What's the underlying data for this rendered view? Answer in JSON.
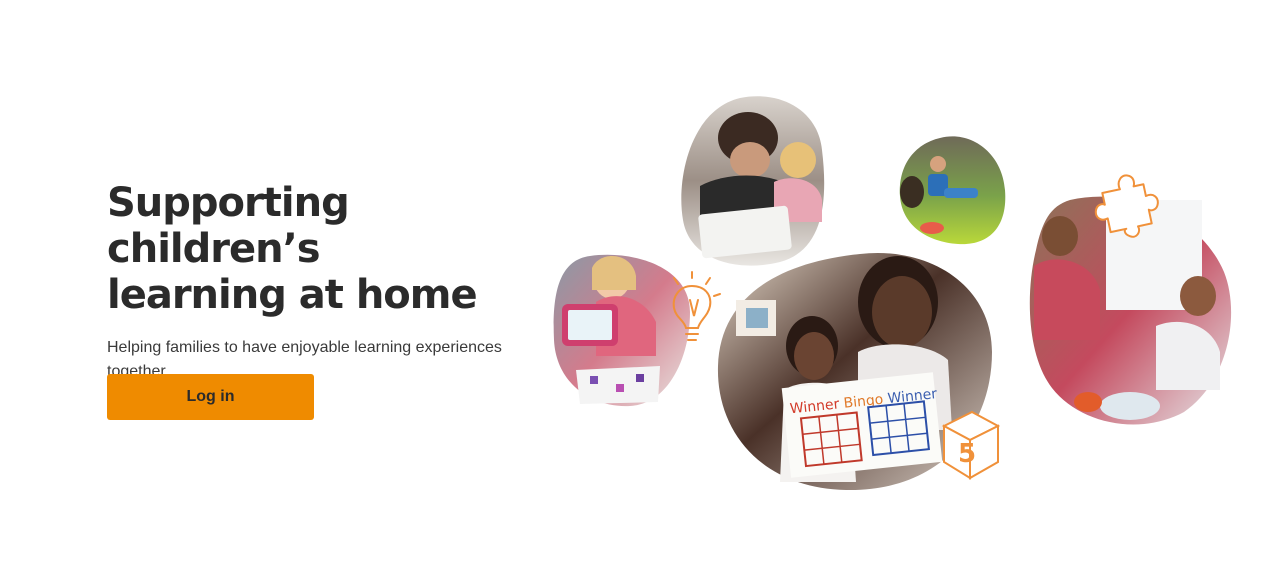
{
  "hero": {
    "headline_line1": "Supporting children’s",
    "headline_line2": "learning at home",
    "subtitle": "Helping families to have enjoyable learning experiences together.",
    "login_label": "Log in"
  },
  "collage": {
    "sign_text_1": "Winner",
    "sign_text_2": "Bingo",
    "sign_text_3": "Winner",
    "dice_number": "5"
  },
  "colors": {
    "accent": "#ef8b00",
    "text": "#2b2b2b",
    "doodle": "#f0913a",
    "background": "#ffffff"
  }
}
